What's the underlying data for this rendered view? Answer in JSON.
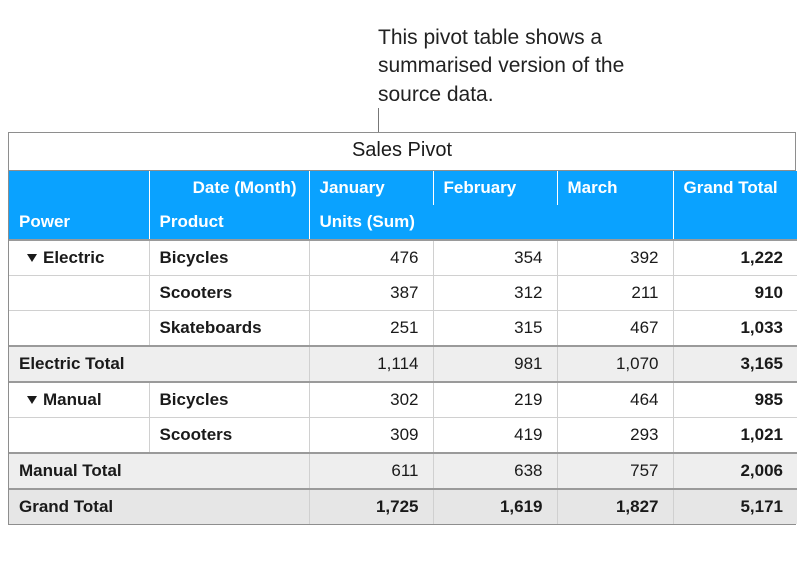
{
  "callout": "This pivot table shows a summarised version of the source data.",
  "title": "Sales Pivot",
  "headers": {
    "date_label": "Date (Month)",
    "months": {
      "jan": "January",
      "feb": "February",
      "mar": "March"
    },
    "grand_total": "Grand Total",
    "power": "Power",
    "product": "Product",
    "units_sum": "Units (Sum)"
  },
  "groups": {
    "electric": {
      "name": "Electric",
      "rows": {
        "bicycles": {
          "product": "Bicycles",
          "jan": "476",
          "feb": "354",
          "mar": "392",
          "total": "1,222"
        },
        "scooters": {
          "product": "Scooters",
          "jan": "387",
          "feb": "312",
          "mar": "211",
          "total": "910"
        },
        "skateboards": {
          "product": "Skateboards",
          "jan": "251",
          "feb": "315",
          "mar": "467",
          "total": "1,033"
        }
      },
      "subtotal": {
        "label": "Electric Total",
        "jan": "1,114",
        "feb": "981",
        "mar": "1,070",
        "total": "3,165"
      }
    },
    "manual": {
      "name": "Manual",
      "rows": {
        "bicycles": {
          "product": "Bicycles",
          "jan": "302",
          "feb": "219",
          "mar": "464",
          "total": "985"
        },
        "scooters": {
          "product": "Scooters",
          "jan": "309",
          "feb": "419",
          "mar": "293",
          "total": "1,021"
        }
      },
      "subtotal": {
        "label": "Manual Total",
        "jan": "611",
        "feb": "638",
        "mar": "757",
        "total": "2,006"
      }
    }
  },
  "grand": {
    "label": "Grand Total",
    "jan": "1,725",
    "feb": "1,619",
    "mar": "1,827",
    "total": "5,171"
  },
  "chart_data": {
    "type": "table",
    "title": "Sales Pivot — Units (Sum) by Power/Product × Month",
    "columns": [
      "Power",
      "Product",
      "January",
      "February",
      "March",
      "Grand Total"
    ],
    "rows": [
      [
        "Electric",
        "Bicycles",
        476,
        354,
        392,
        1222
      ],
      [
        "Electric",
        "Scooters",
        387,
        312,
        211,
        910
      ],
      [
        "Electric",
        "Skateboards",
        251,
        315,
        467,
        1033
      ],
      [
        "Electric",
        "Total",
        1114,
        981,
        1070,
        3165
      ],
      [
        "Manual",
        "Bicycles",
        302,
        219,
        464,
        985
      ],
      [
        "Manual",
        "Scooters",
        309,
        419,
        293,
        1021
      ],
      [
        "Manual",
        "Total",
        611,
        638,
        757,
        2006
      ],
      [
        "Grand Total",
        "",
        1725,
        1619,
        1827,
        5171
      ]
    ]
  }
}
